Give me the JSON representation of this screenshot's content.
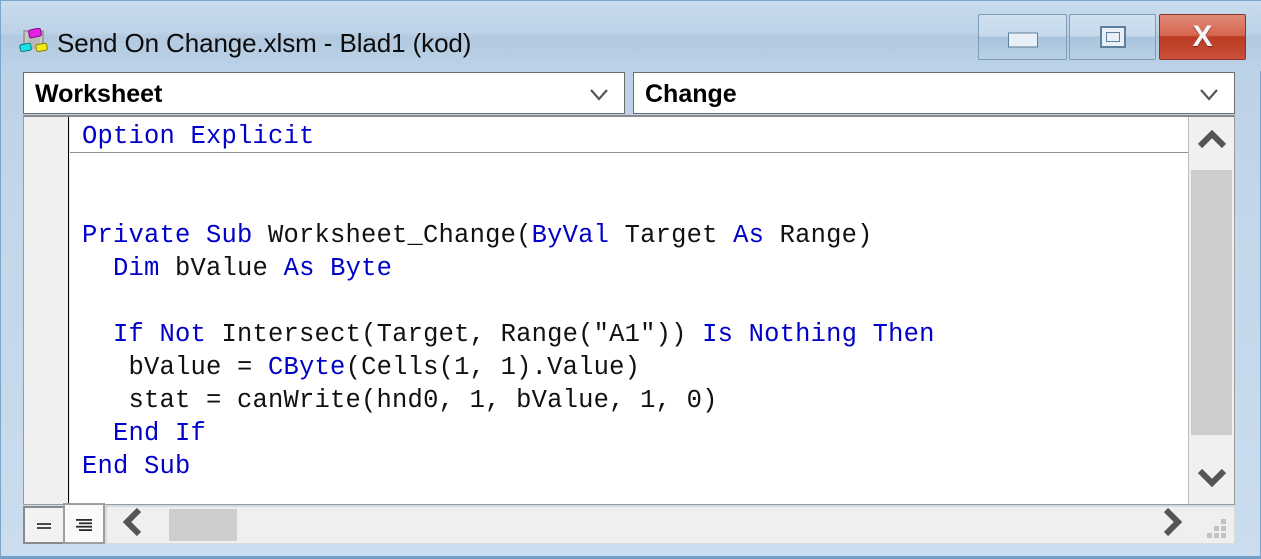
{
  "window": {
    "title": "Send On Change.xlsm - Blad1 (kod)",
    "icon": "vba-project-icon",
    "controls": {
      "minimize_label": "Minimize",
      "maximize_label": "Restore",
      "close_label": "X"
    },
    "colors": {
      "titlebar_top": "#c9dcee",
      "titlebar_bottom": "#bcd2e8",
      "frame": "#b9cfe4",
      "close_button": "#bb3a22",
      "keyword_blue": "#0000c8",
      "code_background": "#ffffff",
      "scroll_thumb": "#cdcdcd"
    }
  },
  "combos": {
    "object": {
      "value": "Worksheet",
      "arrow": "chevron-down-icon"
    },
    "procedure": {
      "value": "Change",
      "arrow": "chevron-down-icon"
    }
  },
  "code": {
    "lines": [
      {
        "indent": 0,
        "tokens": [
          {
            "t": "Option Explicit",
            "kw": true
          }
        ]
      },
      {
        "indent": 0,
        "tokens": []
      },
      {
        "indent": 0,
        "tokens": []
      },
      {
        "indent": 0,
        "tokens": [
          {
            "t": "Private Sub ",
            "kw": true
          },
          {
            "t": "Worksheet_Change(",
            "kw": false
          },
          {
            "t": "ByVal ",
            "kw": true
          },
          {
            "t": "Target ",
            "kw": false
          },
          {
            "t": "As ",
            "kw": true
          },
          {
            "t": "Range)",
            "kw": false
          }
        ]
      },
      {
        "indent": 2,
        "tokens": [
          {
            "t": "Dim ",
            "kw": true
          },
          {
            "t": "bValue ",
            "kw": false
          },
          {
            "t": "As ",
            "kw": true
          },
          {
            "t": "Byte",
            "kw": true
          }
        ]
      },
      {
        "indent": 0,
        "tokens": []
      },
      {
        "indent": 2,
        "tokens": [
          {
            "t": "If Not ",
            "kw": true
          },
          {
            "t": "Intersect(Target, Range(\"A1\")) ",
            "kw": false
          },
          {
            "t": "Is Nothing Then",
            "kw": true
          }
        ]
      },
      {
        "indent": 3,
        "tokens": [
          {
            "t": "bValue = ",
            "kw": false
          },
          {
            "t": "CByte",
            "kw": true
          },
          {
            "t": "(Cells(1, 1).Value)",
            "kw": false
          }
        ]
      },
      {
        "indent": 3,
        "tokens": [
          {
            "t": "stat = canWrite(hnd0, 1, bValue, 1, 0)",
            "kw": false
          }
        ]
      },
      {
        "indent": 2,
        "tokens": [
          {
            "t": "End If",
            "kw": true
          }
        ]
      },
      {
        "indent": 0,
        "tokens": [
          {
            "t": "End Sub",
            "kw": true
          }
        ]
      }
    ],
    "full_text": "Option Explicit\n\n\nPrivate Sub Worksheet_Change(ByVal Target As Range)\n  Dim bValue As Byte\n\n  If Not Intersect(Target, Range(\"A1\")) Is Nothing Then\n    bValue = CByte(Cells(1, 1).Value)\n    stat = canWrite(hnd0, 1, bValue, 1, 0)\n  End If\nEnd Sub"
  },
  "scrollbars": {
    "vertical": {
      "up_arrow": "chevron-up-icon",
      "down_arrow": "chevron-down-icon"
    },
    "horizontal": {
      "left_arrow": "chevron-left-icon",
      "right_arrow": "chevron-right-icon"
    }
  },
  "view_buttons": {
    "procedure_view": "procedure-view-icon",
    "full_module_view": "full-module-view-icon"
  },
  "resize_grip": "resize-grip-icon"
}
